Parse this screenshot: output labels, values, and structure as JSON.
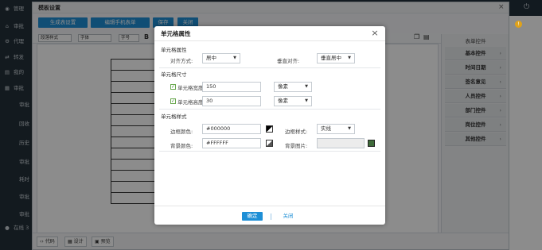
{
  "topbar": {
    "user_label": "管理",
    "icons": [
      "search-icon",
      "power-icon"
    ]
  },
  "sidebar": {
    "items": [
      {
        "icon": "home-icon",
        "label": "审批"
      },
      {
        "icon": "settings-icon",
        "label": "代理"
      },
      {
        "icon": "forward-icon",
        "label": "转发"
      },
      {
        "icon": "doc-icon",
        "label": "我的"
      },
      {
        "icon": "audit-icon",
        "label": "审批"
      }
    ],
    "subitems": [
      "审批",
      "回收",
      "历史",
      "审批",
      "耗时",
      "审批",
      "审批"
    ],
    "online_label": "在线 3"
  },
  "window": {
    "title": "模板设置",
    "buttons": [
      "生成表设置",
      "编辑手机表单",
      "保存",
      "关闭"
    ],
    "format_selects": [
      "段落样式",
      "字体",
      "字号"
    ],
    "right_panel": {
      "header": "表单控件",
      "items": [
        "基本控件",
        "时间日期",
        "签名意见",
        "人员控件",
        "部门控件",
        "岗位控件",
        "其他控件"
      ]
    },
    "bottom_tabs": [
      "代码",
      "设计",
      "预览"
    ]
  },
  "dialog": {
    "title": "单元格属性",
    "section_cell": "单元格属性",
    "h_align_label": "对齐方式:",
    "h_align_value": "居中",
    "v_align_label": "垂直对齐:",
    "v_align_value": "垂直居中",
    "section_size": "单元格尺寸",
    "width_label": "单元格宽度:",
    "width_value": "150",
    "width_unit": "像素",
    "height_label": "单元格高度:",
    "height_value": "30",
    "height_unit": "像素",
    "section_style": "单元格样式",
    "border_color_label": "边框颜色:",
    "border_color_value": "#000000",
    "border_style_label": "边框样式:",
    "border_style_value": "实线",
    "bg_color_label": "背景颜色:",
    "bg_color_value": "#FFFFFF",
    "bg_image_label": "背景图片:",
    "ok_label": "确定",
    "close_label": "关闭"
  }
}
